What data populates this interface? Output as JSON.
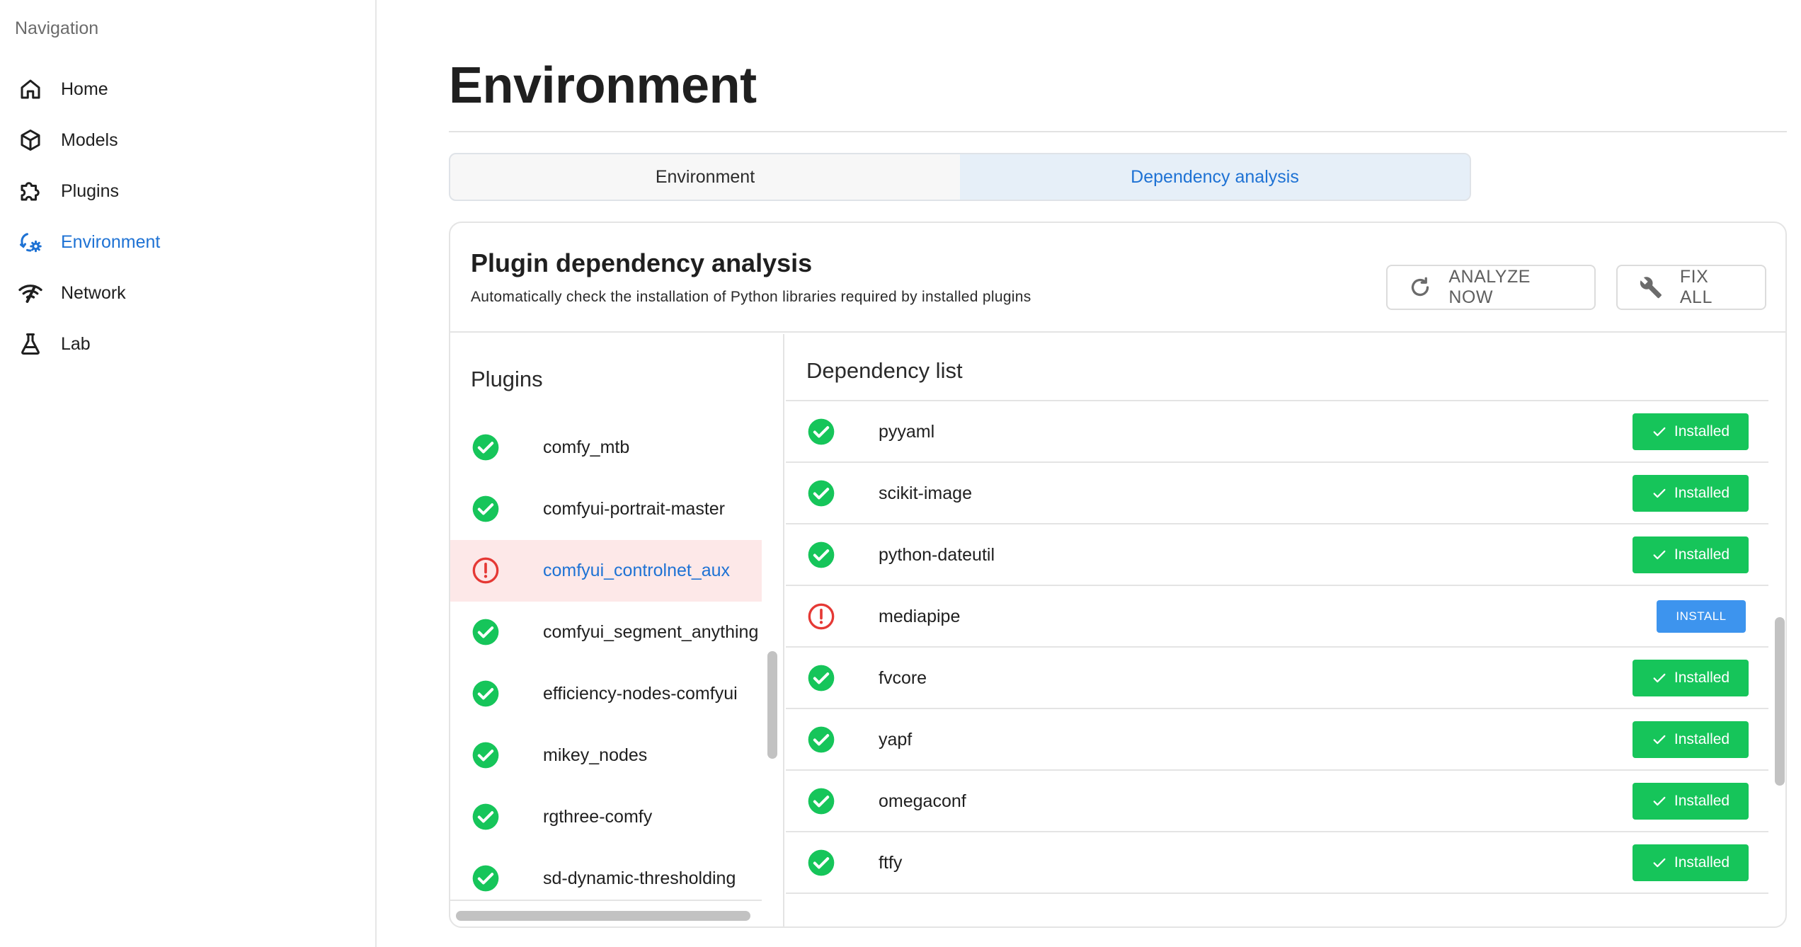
{
  "sidebar": {
    "heading": "Navigation",
    "items": [
      {
        "label": "Home",
        "icon": "home-icon"
      },
      {
        "label": "Models",
        "icon": "cube-icon"
      },
      {
        "label": "Plugins",
        "icon": "puzzle-icon"
      },
      {
        "label": "Environment",
        "icon": "environment-sync-icon",
        "active": true
      },
      {
        "label": "Network",
        "icon": "wifi-icon"
      },
      {
        "label": "Lab",
        "icon": "flask-icon"
      }
    ]
  },
  "page": {
    "title": "Environment"
  },
  "tabs": [
    {
      "label": "Environment",
      "active": false
    },
    {
      "label": "Dependency analysis",
      "active": true
    }
  ],
  "card": {
    "title": "Plugin dependency analysis",
    "subtitle": "Automatically check the installation of Python libraries required by installed plugins",
    "analyze_label": "ANALYZE NOW",
    "fix_label": "FIX ALL"
  },
  "plugins": {
    "title": "Plugins",
    "items": [
      {
        "name": "comfy_mtb",
        "status": "ok"
      },
      {
        "name": "comfyui-portrait-master",
        "status": "ok"
      },
      {
        "name": "comfyui_controlnet_aux",
        "status": "error",
        "selected": true
      },
      {
        "name": "comfyui_segment_anything",
        "status": "ok"
      },
      {
        "name": "efficiency-nodes-comfyui",
        "status": "ok"
      },
      {
        "name": "mikey_nodes",
        "status": "ok"
      },
      {
        "name": "rgthree-comfy",
        "status": "ok"
      },
      {
        "name": "sd-dynamic-thresholding",
        "status": "ok"
      }
    ]
  },
  "dependencies": {
    "title": "Dependency list",
    "installed_label": "Installed",
    "install_label": "INSTALL",
    "items": [
      {
        "name": "pyyaml",
        "status": "ok"
      },
      {
        "name": "scikit-image",
        "status": "ok"
      },
      {
        "name": "python-dateutil",
        "status": "ok"
      },
      {
        "name": "mediapipe",
        "status": "error"
      },
      {
        "name": "fvcore",
        "status": "ok"
      },
      {
        "name": "yapf",
        "status": "ok"
      },
      {
        "name": "omegaconf",
        "status": "ok"
      },
      {
        "name": "ftfy",
        "status": "ok"
      }
    ]
  },
  "colors": {
    "accent": "#1e72d4",
    "ok": "#16c55a",
    "error": "#e53935",
    "install": "#3d94ee",
    "selected_row": "#fde8e8"
  }
}
